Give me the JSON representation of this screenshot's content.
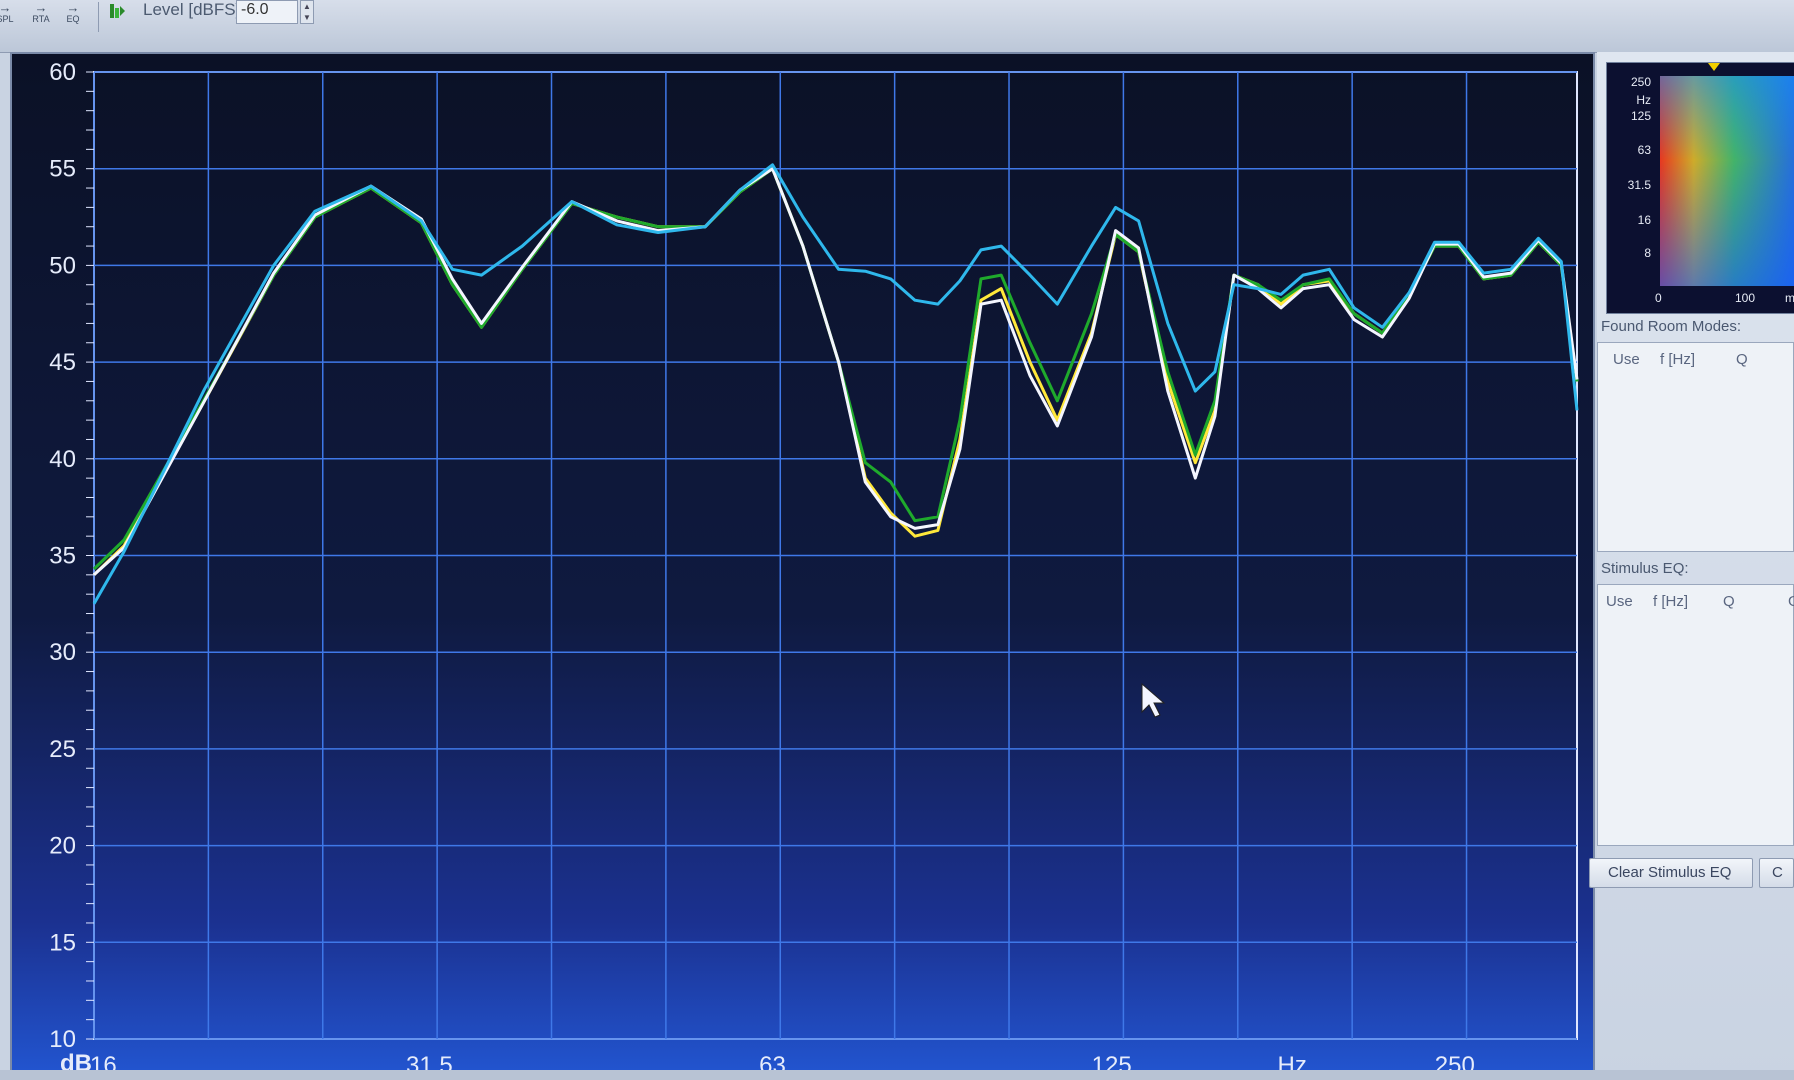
{
  "toolbar": {
    "buttons": [
      {
        "label": "SPL",
        "icon": "arrow-right-icon"
      },
      {
        "label": "RTA",
        "icon": "arrow-right-icon"
      },
      {
        "label": "EQ",
        "icon": "arrow-right-icon"
      }
    ],
    "level_label": "Level [dBFS]",
    "level_value": "-6.0"
  },
  "graph": {
    "y_unit_label": "dB",
    "x_unit_label": "Hz",
    "colors": {
      "grid": "#3f78e8",
      "axis_text": "#e6ecfb",
      "trace_yellow": "#ffe83a",
      "trace_green": "#1faa2c",
      "trace_white": "#f4f6ff",
      "trace_blue": "#2fb8ec"
    }
  },
  "chart_data": {
    "type": "line",
    "title": "",
    "xlabel": "Hz",
    "ylabel": "dB",
    "x_scale": "log",
    "xlim": [
      16,
      320
    ],
    "ylim": [
      10,
      60
    ],
    "grid": true,
    "x_tick_labels": [
      "16",
      "31.5",
      "63",
      "125",
      "250"
    ],
    "y_tick_labels": [
      "60",
      "55",
      "50",
      "45",
      "40",
      "35",
      "30",
      "25",
      "20",
      "15",
      "10"
    ],
    "series": [
      {
        "color": "#ffe83a",
        "x": [
          16,
          17,
          20,
          23,
          25,
          28,
          31,
          33,
          35,
          38,
          42,
          46,
          50,
          55,
          59,
          63,
          67,
          72,
          76,
          80,
          84,
          88,
          92,
          96,
          100,
          106,
          112,
          120,
          126,
          132,
          140,
          148,
          154,
          160,
          168,
          176,
          184,
          194,
          204,
          216,
          228,
          240,
          252,
          265,
          280,
          296,
          310,
          320
        ],
        "y": [
          34,
          35.5,
          43,
          49.5,
          52.5,
          54,
          52.2,
          49,
          46.8,
          49.8,
          53.2,
          52.5,
          52,
          52,
          53.8,
          55,
          51,
          45,
          39,
          37.2,
          36,
          36.3,
          41,
          48.2,
          48.8,
          45,
          42,
          46.5,
          51.6,
          50.7,
          44,
          39.8,
          42.5,
          49.5,
          49,
          48,
          49,
          49.2,
          47.5,
          46.5,
          48.5,
          51,
          51,
          49.3,
          49.5,
          51.2,
          50,
          44
        ]
      },
      {
        "color": "#1faa2c",
        "x": [
          16,
          17,
          20,
          23,
          25,
          28,
          31,
          33,
          35,
          38,
          42,
          46,
          50,
          55,
          59,
          63,
          67,
          72,
          76,
          80,
          84,
          88,
          92,
          96,
          100,
          106,
          112,
          120,
          126,
          132,
          140,
          148,
          154,
          160,
          168,
          176,
          184,
          194,
          204,
          216,
          228,
          240,
          252,
          265,
          280,
          296,
          310,
          320
        ],
        "y": [
          34.3,
          35.8,
          43.1,
          49.5,
          52.5,
          54,
          52.2,
          49,
          46.8,
          49.8,
          53.2,
          52.5,
          52,
          52,
          53.8,
          55,
          51,
          45,
          39.8,
          38.8,
          36.8,
          37,
          42,
          49.3,
          49.5,
          46,
          43,
          47.5,
          51.6,
          50.7,
          44.5,
          40.2,
          43,
          49.5,
          49,
          48.2,
          49,
          49.3,
          47.5,
          46.5,
          48.5,
          51,
          51,
          49.3,
          49.5,
          51.2,
          50,
          44
        ]
      },
      {
        "color": "#f4f6ff",
        "x": [
          16,
          17,
          20,
          23,
          25,
          28,
          31,
          33,
          35,
          38,
          42,
          46,
          50,
          55,
          59,
          63,
          67,
          72,
          76,
          80,
          84,
          88,
          92,
          96,
          100,
          106,
          112,
          120,
          126,
          132,
          140,
          148,
          154,
          160,
          168,
          176,
          184,
          194,
          204,
          216,
          228,
          240,
          252,
          265,
          280,
          296,
          310,
          320
        ],
        "y": [
          34,
          35.4,
          43,
          49.6,
          52.6,
          54.1,
          52.4,
          49.3,
          47,
          49.9,
          53.3,
          52.3,
          51.8,
          52,
          53.9,
          55,
          51,
          45,
          38.8,
          37,
          36.4,
          36.6,
          40.5,
          48,
          48.2,
          44.3,
          41.7,
          46.3,
          51.8,
          50.9,
          43.5,
          39,
          42.2,
          49.5,
          48.8,
          47.8,
          48.8,
          49,
          47.2,
          46.3,
          48.3,
          51.1,
          51.1,
          49.4,
          49.6,
          51.3,
          50.1,
          44.1
        ]
      },
      {
        "color": "#2fb8ec",
        "x": [
          16,
          17,
          20,
          23,
          25,
          28,
          31,
          33,
          35,
          38,
          42,
          46,
          50,
          55,
          59,
          63,
          67,
          72,
          76,
          80,
          84,
          88,
          92,
          96,
          100,
          106,
          112,
          120,
          126,
          132,
          140,
          148,
          154,
          160,
          168,
          176,
          184,
          194,
          204,
          216,
          228,
          240,
          252,
          265,
          280,
          296,
          310,
          320
        ],
        "y": [
          32.5,
          35.2,
          43.6,
          50,
          52.8,
          54.1,
          52.3,
          49.8,
          49.5,
          51,
          53.3,
          52.1,
          51.7,
          52,
          53.9,
          55.2,
          52.5,
          49.8,
          49.7,
          49.3,
          48.2,
          48,
          49.2,
          50.8,
          51,
          49.5,
          48,
          51,
          53,
          52.3,
          47,
          43.5,
          44.5,
          49,
          48.8,
          48.5,
          49.5,
          49.8,
          47.8,
          46.8,
          48.6,
          51.2,
          51.2,
          49.6,
          49.8,
          51.4,
          50.2,
          42.5
        ]
      }
    ]
  },
  "side_panel": {
    "waterfall": {
      "y_ticks": [
        "250",
        "Hz",
        "125",
        "63",
        "31.5",
        "16",
        "8"
      ],
      "x_ticks": [
        "0",
        "100",
        "m"
      ]
    },
    "room_modes": {
      "title": "Found Room Modes:",
      "columns": [
        "Use",
        "f [Hz]",
        "Q"
      ]
    },
    "stimulus_eq": {
      "title": "Stimulus EQ:",
      "columns": [
        "Use",
        "f [Hz]",
        "Q",
        "G"
      ]
    },
    "buttons": {
      "clear": "Clear Stimulus EQ",
      "second": "C"
    }
  }
}
